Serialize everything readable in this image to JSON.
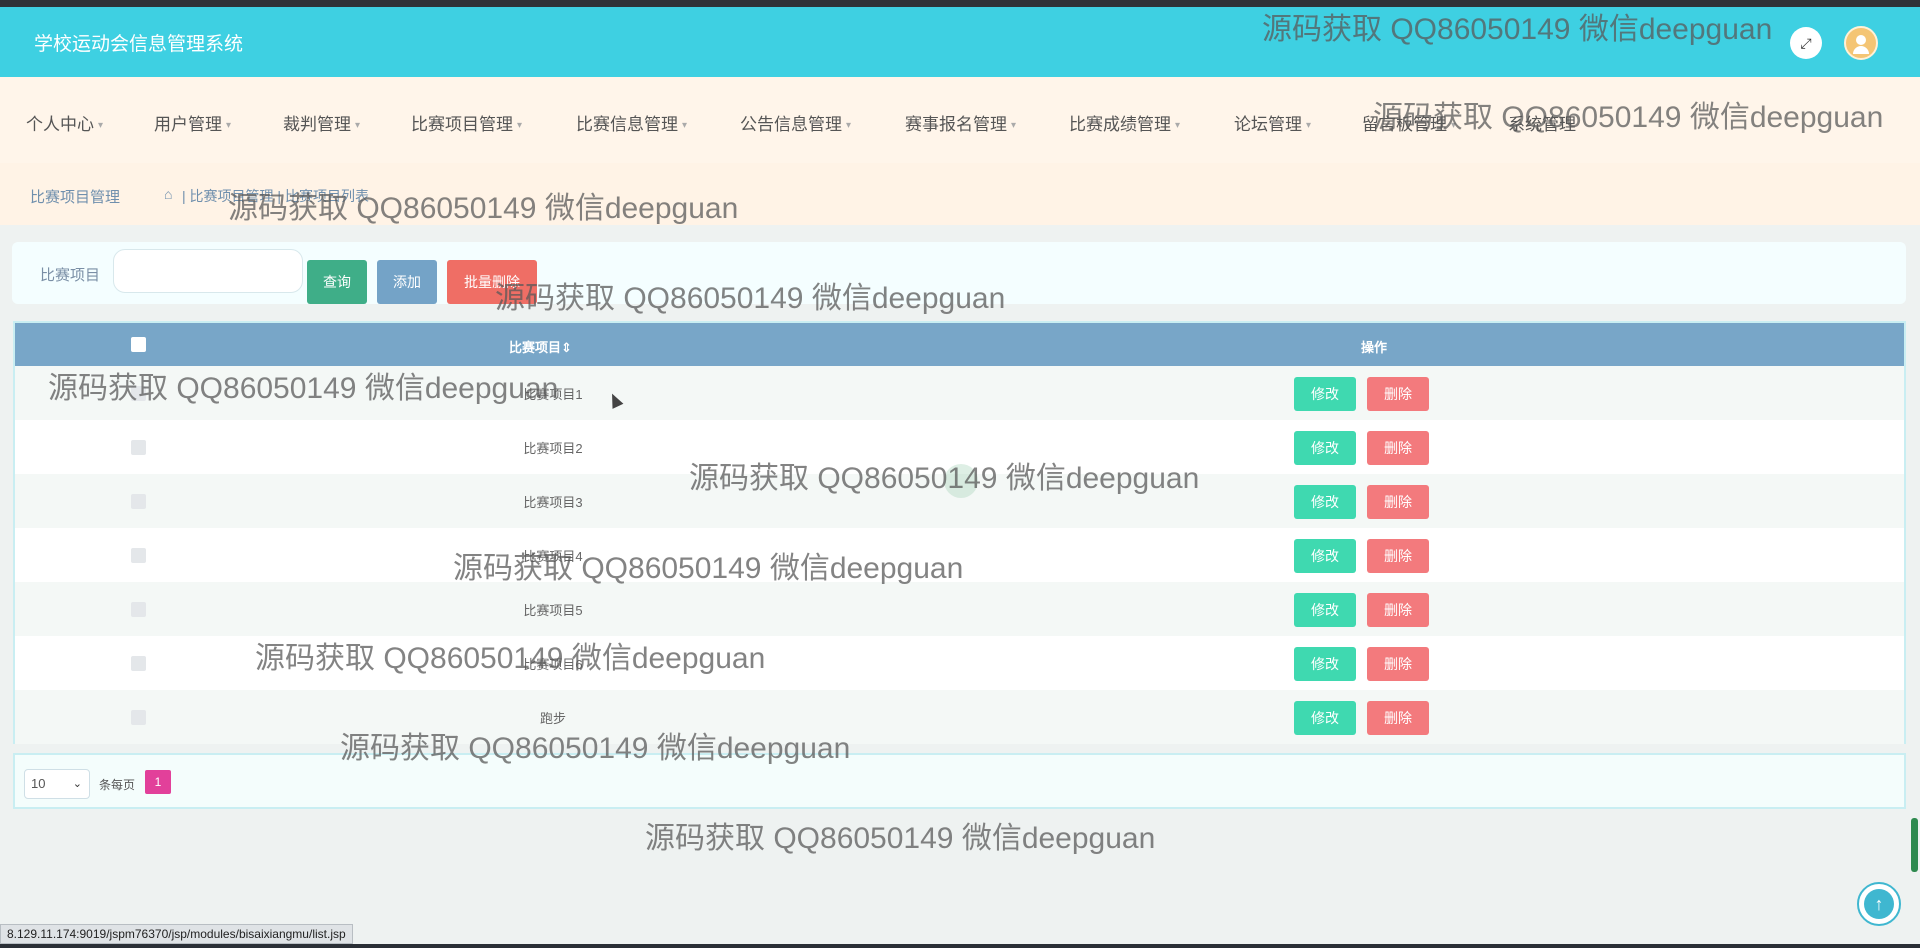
{
  "header": {
    "app_title": "学校运动会信息管理系统",
    "fullscreen_icon": "⤢"
  },
  "nav": {
    "items": [
      {
        "label": "个人中心"
      },
      {
        "label": "用户管理"
      },
      {
        "label": "裁判管理"
      },
      {
        "label": "比赛项目管理"
      },
      {
        "label": "比赛信息管理"
      },
      {
        "label": "公告信息管理"
      },
      {
        "label": "赛事报名管理"
      },
      {
        "label": "比赛成绩管理"
      },
      {
        "label": "论坛管理"
      },
      {
        "label": "留言板管理"
      },
      {
        "label": "系统管理"
      }
    ],
    "caret": "▾"
  },
  "breadcrumb": {
    "title": "比赛项目管理",
    "home_icon": "⌂",
    "path": "| 比赛项目管理 | 比赛项目列表"
  },
  "search": {
    "label": "比赛项目",
    "input_value": "",
    "search_button": "查询",
    "add_button": "添加",
    "batch_delete_button": "批量删除"
  },
  "table": {
    "columns": [
      "比赛项目⇕",
      "操作"
    ],
    "rows": [
      {
        "name": "比赛项目1"
      },
      {
        "name": "比赛项目2"
      },
      {
        "name": "比赛项目3"
      },
      {
        "name": "比赛项目4"
      },
      {
        "name": "比赛项目5"
      },
      {
        "name": "比赛项目6"
      },
      {
        "name": "跑步"
      }
    ],
    "edit_label": "修改",
    "delete_label": "删除"
  },
  "pager": {
    "page_size": "10",
    "page_size_arrow": "⌄",
    "per_page_label": "条每页",
    "current_page": "1"
  },
  "scroll_top_icon": "↑",
  "status_url": "8.129.11.174:9019/jspm76370/jsp/modules/bisaixiangmu/list.jsp",
  "watermark": "源码获取 QQ86050149 微信deepguan",
  "colors": {
    "header": "#3ed0e2",
    "edit": "#3fd9b0",
    "delete": "#f37a7d",
    "table_header": "#78a6c8",
    "page_active": "#e2409a"
  }
}
